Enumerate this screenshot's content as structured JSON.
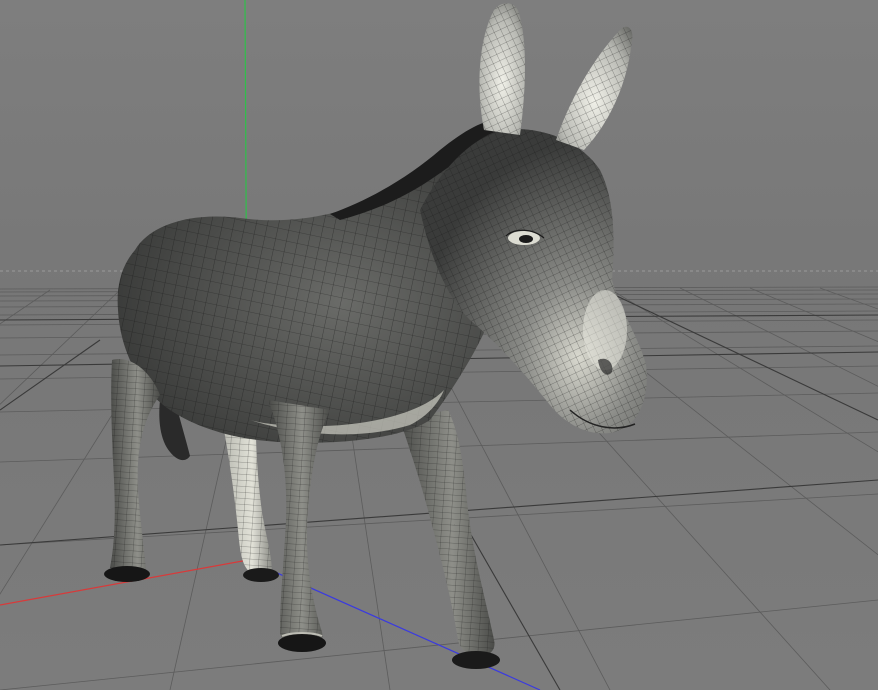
{
  "viewport": {
    "kind": "3d-perspective-view",
    "shading": "gouraud-with-wireframe",
    "subject": "donkey-mesh"
  },
  "colors": {
    "background": "#7a7a7a",
    "grid_line": "#5a5a5a",
    "grid_major": "#3c3c3c",
    "axis_x": "#d83a3a",
    "axis_y": "#2fc04a",
    "axis_z": "#3a3ae0",
    "mesh_dark": "#2f302f",
    "mesh_mid": "#565856",
    "mesh_light": "#e6e6dc",
    "wire": "#151515"
  },
  "icons": {
    "origin": "world-origin-icon"
  }
}
